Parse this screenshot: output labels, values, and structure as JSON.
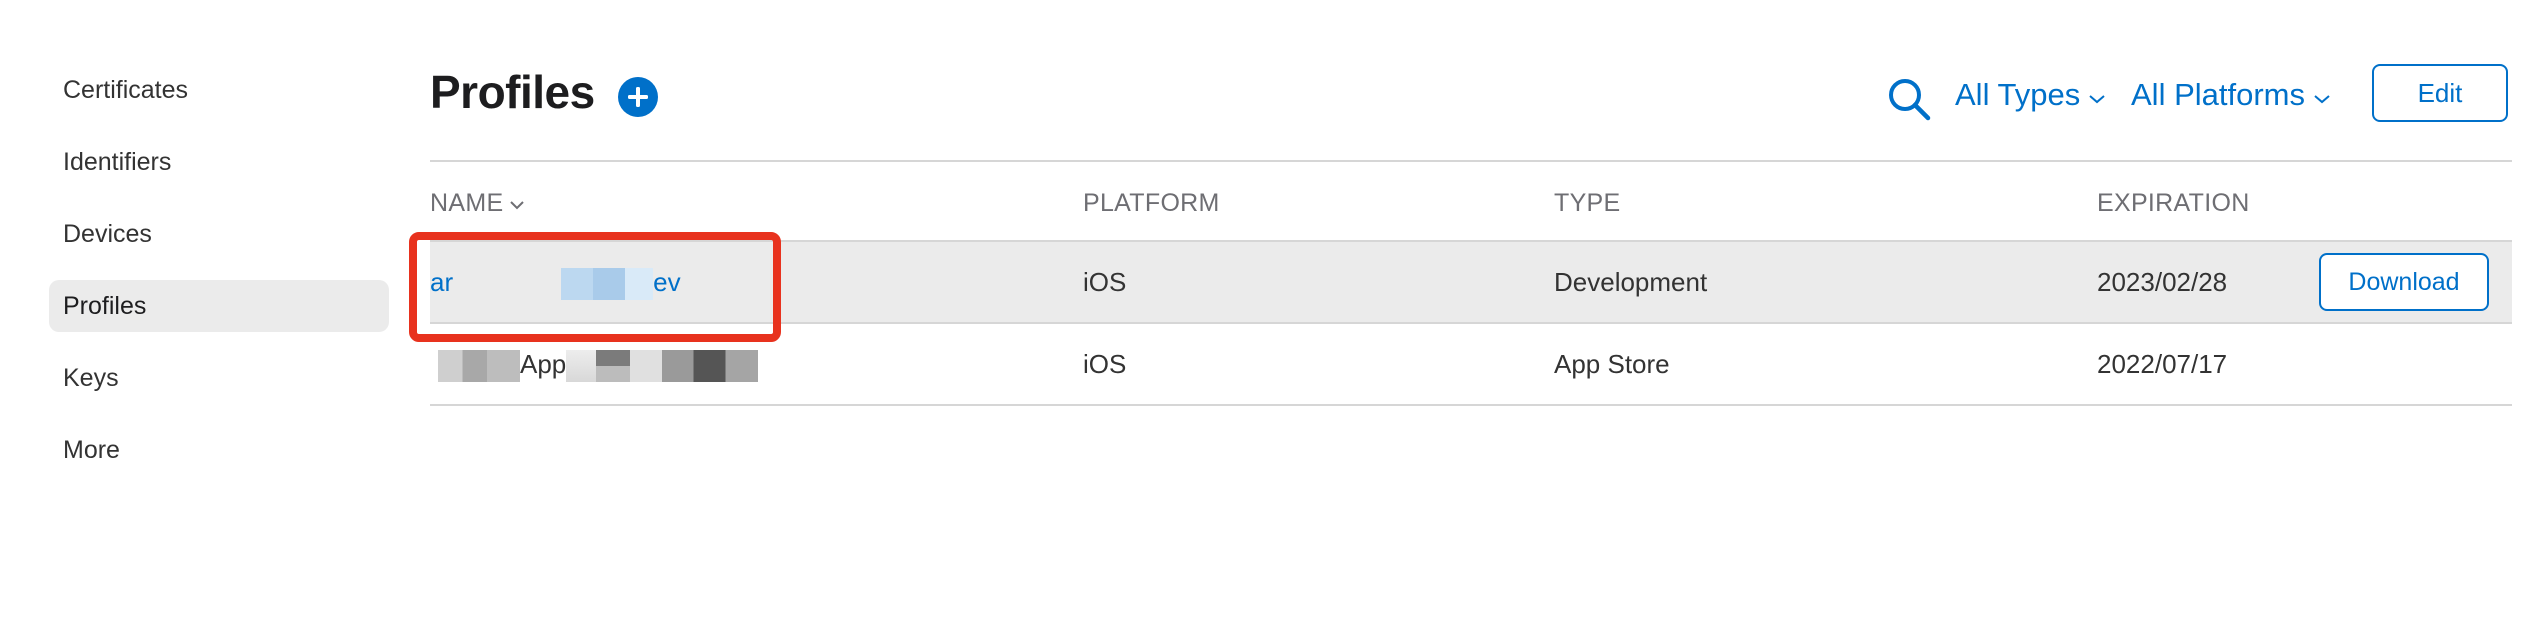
{
  "sidebar": {
    "items": [
      {
        "label": "Certificates",
        "active": false
      },
      {
        "label": "Identifiers",
        "active": false
      },
      {
        "label": "Devices",
        "active": false
      },
      {
        "label": "Profiles",
        "active": true
      },
      {
        "label": "Keys",
        "active": false
      },
      {
        "label": "More",
        "active": false
      }
    ]
  },
  "header": {
    "title": "Profiles",
    "add_icon": "plus-circle-icon",
    "search_icon": "search-icon",
    "filter_types": "All Types",
    "filter_platforms": "All Platforms",
    "edit_label": "Edit"
  },
  "table": {
    "columns": {
      "name": "NAME",
      "platform": "PLATFORM",
      "type": "TYPE",
      "expiration": "EXPIRATION"
    },
    "rows": [
      {
        "name_start": "ar",
        "name_end": "ev",
        "platform": "iOS",
        "type": "Development",
        "expiration": "2023/02/28",
        "action": "Download"
      },
      {
        "name_start": "",
        "name_mid": "App",
        "platform": "iOS",
        "type": "App Store",
        "expiration": "2022/07/17"
      }
    ]
  },
  "colors": {
    "accent": "#0070c9",
    "highlight": "#e8321e",
    "selected_row": "#ebebeb"
  }
}
